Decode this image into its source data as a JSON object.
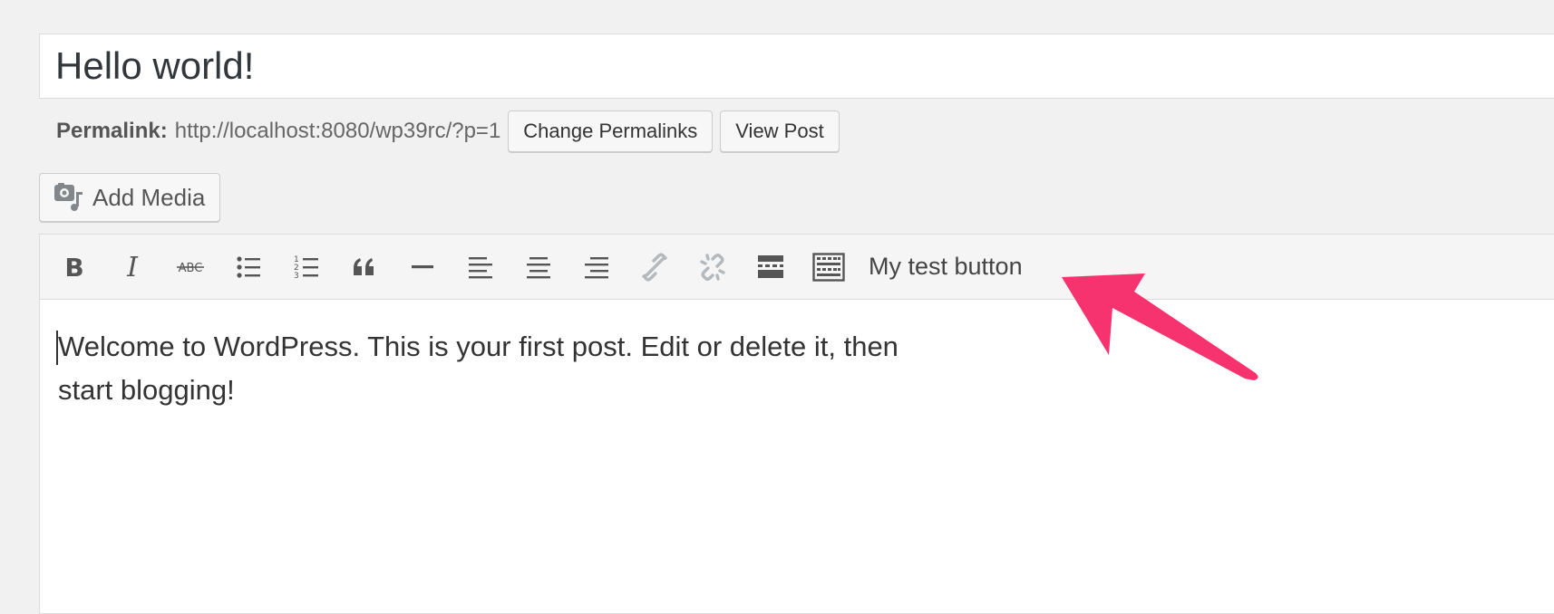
{
  "post": {
    "title": "Hello world!"
  },
  "permalink": {
    "label": "Permalink:",
    "url": "http://localhost:8080/wp39rc/?p=1",
    "change_label": "Change Permalinks",
    "view_label": "View Post"
  },
  "media": {
    "add_media_label": "Add Media"
  },
  "toolbar": {
    "buttons": [
      {
        "name": "bold-icon"
      },
      {
        "name": "italic-icon"
      },
      {
        "name": "strikethrough-icon"
      },
      {
        "name": "bullet-list-icon"
      },
      {
        "name": "numbered-list-icon"
      },
      {
        "name": "blockquote-icon"
      },
      {
        "name": "horizontal-line-icon"
      },
      {
        "name": "align-left-icon"
      },
      {
        "name": "align-center-icon"
      },
      {
        "name": "align-right-icon"
      },
      {
        "name": "link-icon"
      },
      {
        "name": "unlink-icon"
      },
      {
        "name": "read-more-icon"
      },
      {
        "name": "toolbar-toggle-icon"
      }
    ],
    "custom_button_label": "My test button"
  },
  "content": {
    "line1": "Welcome to WordPress. This is your first post. Edit or delete it, then",
    "line2": "start blogging!"
  },
  "annotation": {
    "arrow_color": "#f7336f"
  }
}
